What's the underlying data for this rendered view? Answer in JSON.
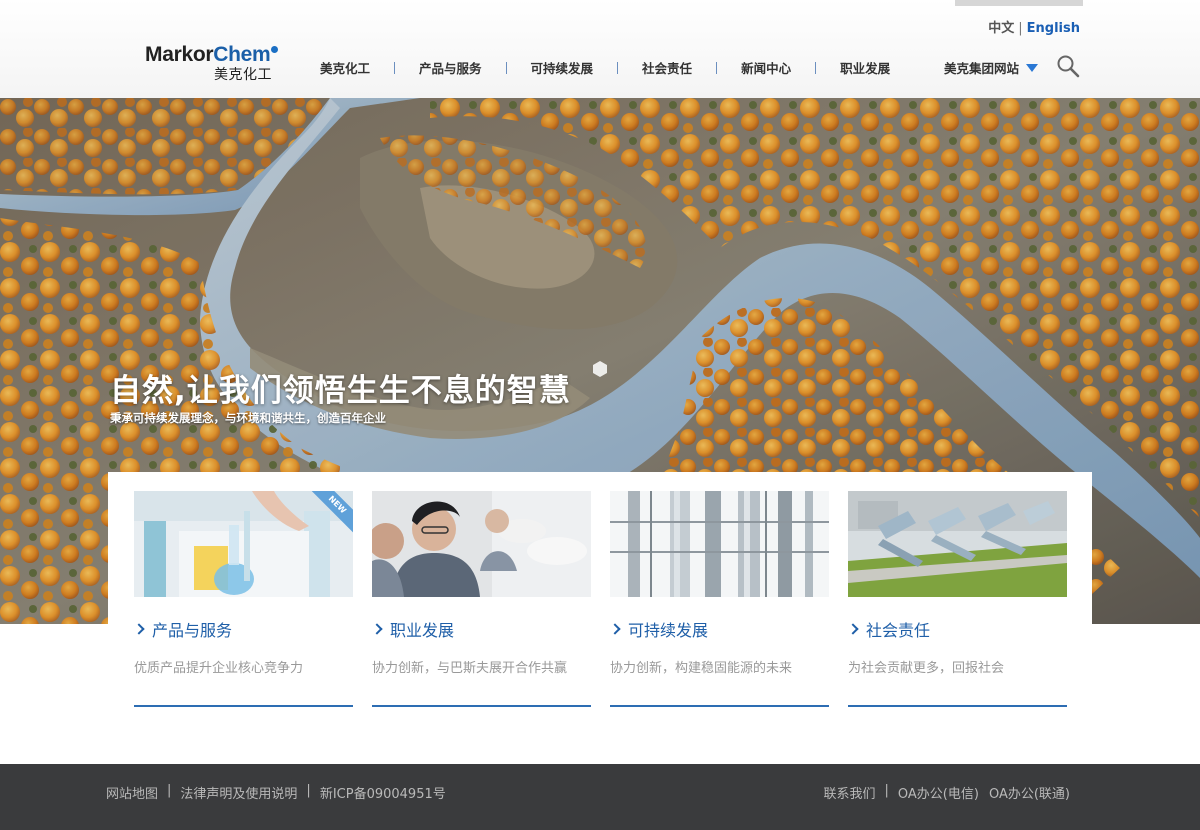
{
  "header": {
    "lang_cn": "中文",
    "lang_sep": "|",
    "lang_en": "English",
    "logo_en_part1": "Markor",
    "logo_en_part2": "Chem",
    "logo_cn": "美克化工",
    "nav": [
      "美克化工",
      "产品与服务",
      "可持续发展",
      "社会责任",
      "新闻中心",
      "职业发展"
    ],
    "group_site_label": "美克集团网站",
    "icons": {
      "search": "search-icon",
      "dropdown": "caret-down-icon"
    }
  },
  "hero": {
    "title": "自然,让我们领悟生生不息的智慧",
    "subtitle": "秉承可持续发展理念，与环境和谐共生，创造百年企业"
  },
  "cards": [
    {
      "title": "产品与服务",
      "desc": "优质产品提升企业核心竞争力",
      "badge": "NEW"
    },
    {
      "title": "职业发展",
      "desc": "协力创新，与巴斯夫展开合作共赢"
    },
    {
      "title": "可持续发展",
      "desc": "协力创新，构建稳固能源的未来"
    },
    {
      "title": "社会责任",
      "desc": "为社会贡献更多，回报社会"
    }
  ],
  "footer": {
    "left": [
      "网站地图",
      "法律声明及使用说明",
      "新ICP备09004951号"
    ],
    "right": [
      "联系我们",
      "OA办公(电信)",
      "OA办公(联通)"
    ],
    "sep": "|"
  },
  "colors": {
    "accent": "#1f5fa8",
    "footer_bg": "#3a3b3d",
    "dropdown": "#2a78d4"
  }
}
